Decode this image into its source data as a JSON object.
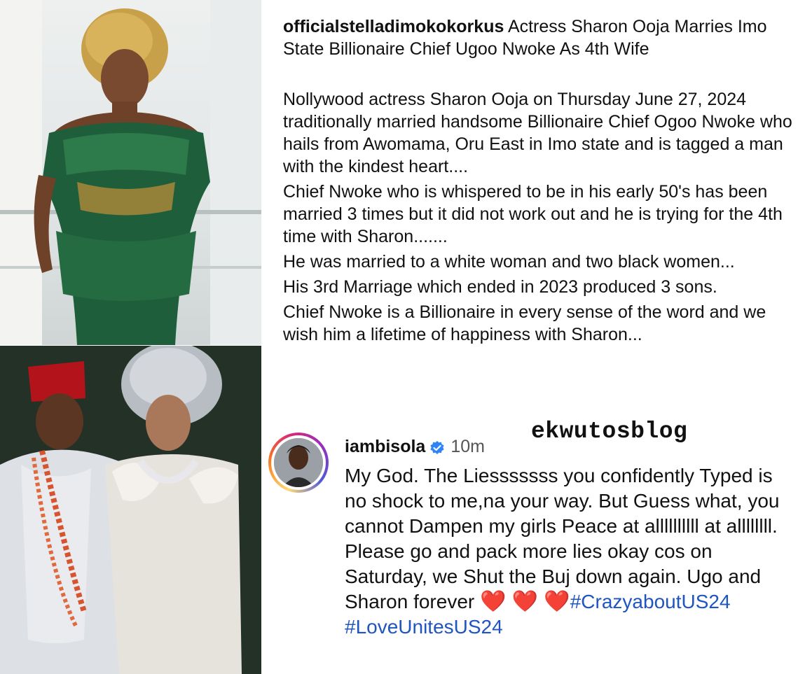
{
  "post": {
    "username": "officialstelladimokokorkus",
    "headline": " Actress Sharon Ooja Marries Imo State Billionaire Chief Ugoo Nwoke As 4th Wife",
    "paragraphs": [
      "Nollywood actress Sharon Ooja on Thursday June 27, 2024 traditionally married handsome Billionaire Chief Ogoo Nwoke who hails from Awomama, Oru East in Imo state and is tagged a man with the kindest heart....",
      "Chief Nwoke who is whispered to be in his early 50's has been married 3 times but it did not work out and he is trying for the 4th time with Sharon.......",
      "He was married to a white woman and two black women...",
      "His 3rd Marriage which ended in 2023 produced 3 sons.",
      "Chief Nwoke is a Billionaire in every sense of the word and we wish him a lifetime of happiness with Sharon..."
    ]
  },
  "watermark": "ekwutosblog",
  "comment": {
    "username": "iambisola",
    "time": "10m",
    "text": "My God. The Liesssssss you confidently Typed is no shock to me,na your way. But Guess what, you cannot Dampen my girls Peace at allllllllll at allllllll. Please go and pack more lies okay cos on Saturday, we Shut the Buj down again. Ugo and Sharon forever ",
    "hearts": "❤️ ❤️ ❤️",
    "hashtag1": "#CrazyaboutUS24",
    "hashtag2": "#LoveUnitesUS24"
  },
  "icons": {
    "verified": "verified-badge-icon",
    "avatar": "avatar",
    "heart": "heart-emoji"
  },
  "colors": {
    "hashtag": "#1f55c0",
    "verified": "#2f84f7",
    "heart": "#e0212d"
  }
}
